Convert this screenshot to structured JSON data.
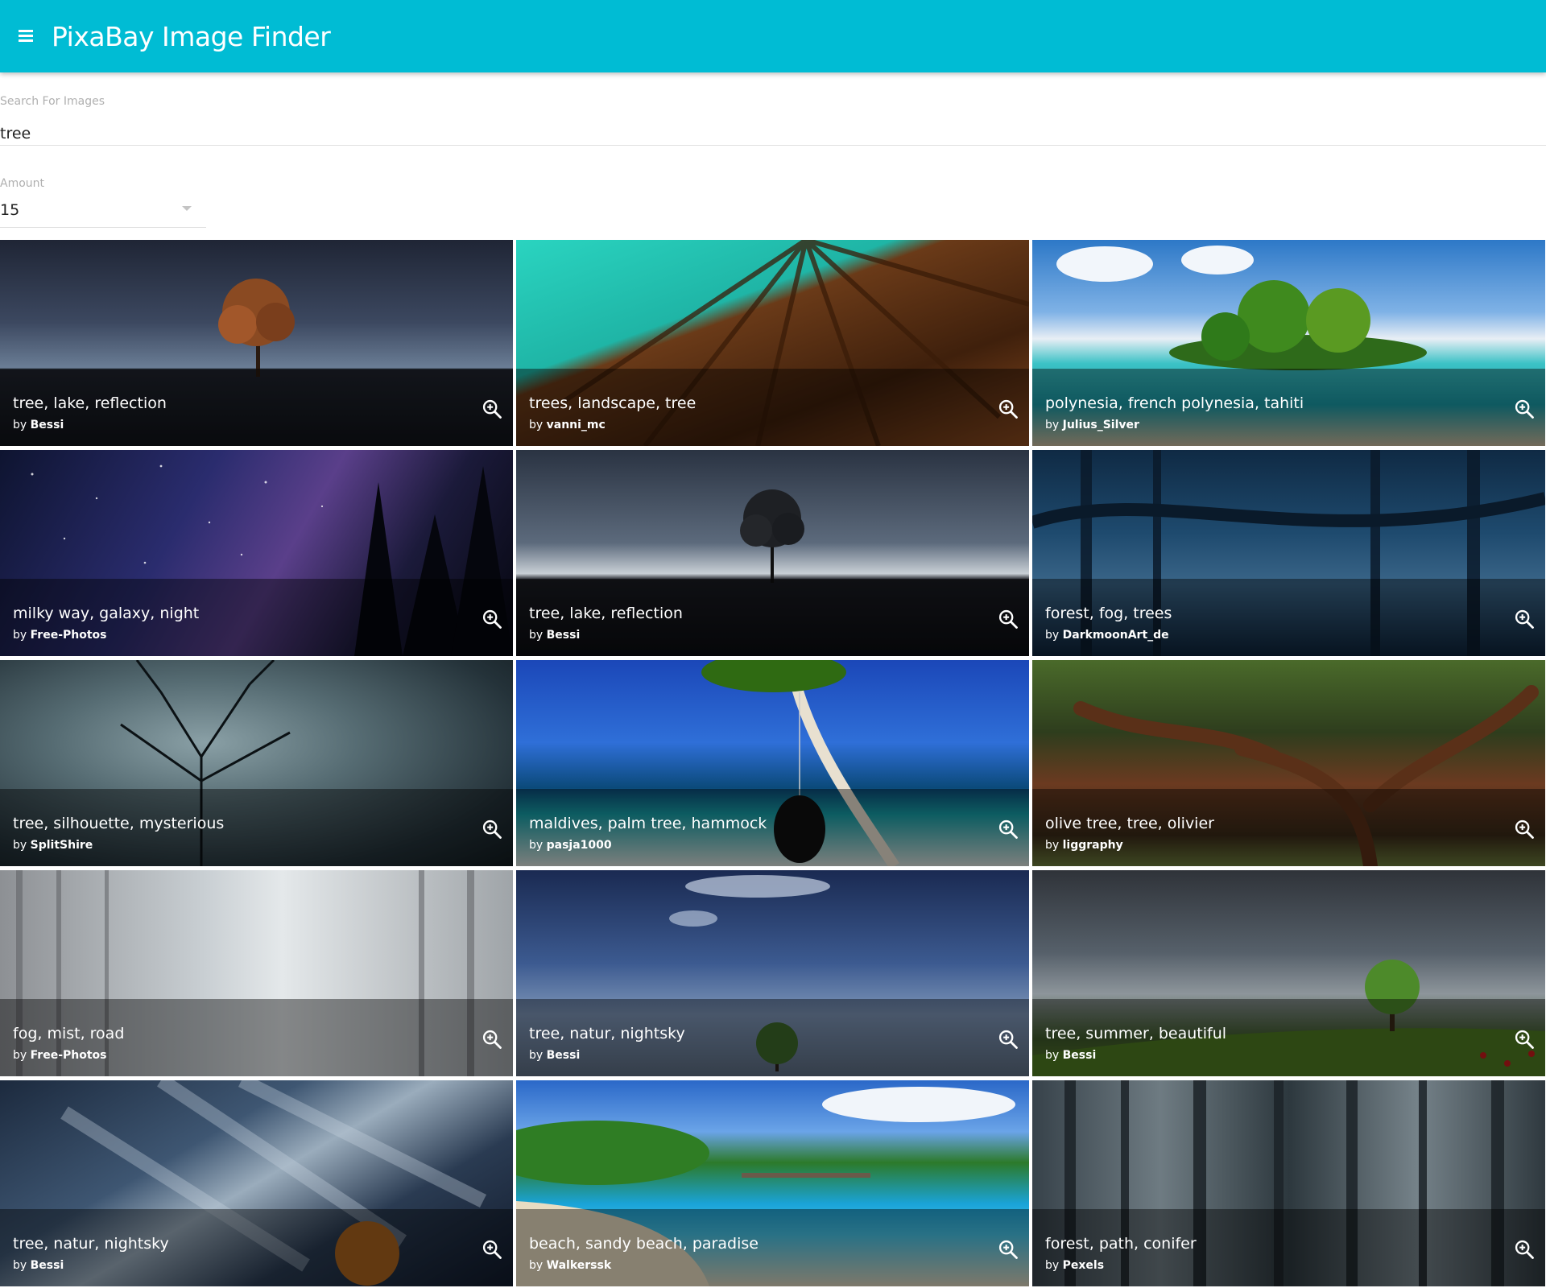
{
  "app": {
    "title": "PixaBay Image Finder"
  },
  "search": {
    "label": "Search For Images",
    "value": "tree"
  },
  "amount": {
    "label": "Amount",
    "value": "15"
  },
  "images": [
    {
      "tags": "tree, lake, reflection",
      "by": "by",
      "author": "Bessi"
    },
    {
      "tags": "trees, landscape, tree",
      "by": "by",
      "author": "vanni_mc"
    },
    {
      "tags": "polynesia, french polynesia, tahiti",
      "by": "by",
      "author": "Julius_Silver"
    },
    {
      "tags": "milky way, galaxy, night",
      "by": "by",
      "author": "Free-Photos"
    },
    {
      "tags": "tree, lake, reflection",
      "by": "by",
      "author": "Bessi"
    },
    {
      "tags": "forest, fog, trees",
      "by": "by",
      "author": "DarkmoonArt_de"
    },
    {
      "tags": "tree, silhouette, mysterious",
      "by": "by",
      "author": "SplitShire"
    },
    {
      "tags": "maldives, palm tree, hammock",
      "by": "by",
      "author": "pasja1000"
    },
    {
      "tags": "olive tree, tree, olivier",
      "by": "by",
      "author": "liggraphy"
    },
    {
      "tags": "fog, mist, road",
      "by": "by",
      "author": "Free-Photos"
    },
    {
      "tags": "tree, natur, nightsky",
      "by": "by",
      "author": "Bessi"
    },
    {
      "tags": "tree, summer, beautiful",
      "by": "by",
      "author": "Bessi"
    },
    {
      "tags": "tree, natur, nightsky",
      "by": "by",
      "author": "Bessi"
    },
    {
      "tags": "beach, sandy beach, paradise",
      "by": "by",
      "author": "Walkerssk"
    },
    {
      "tags": "forest, path, conifer",
      "by": "by",
      "author": "Pexels"
    }
  ],
  "colors": {
    "appbar": "#00bcd4",
    "text": "#212121",
    "label": "#b0b0b0"
  },
  "icons": {
    "menu": "menu-icon",
    "zoom": "zoom-in-icon",
    "caret": "dropdown-caret-icon"
  }
}
